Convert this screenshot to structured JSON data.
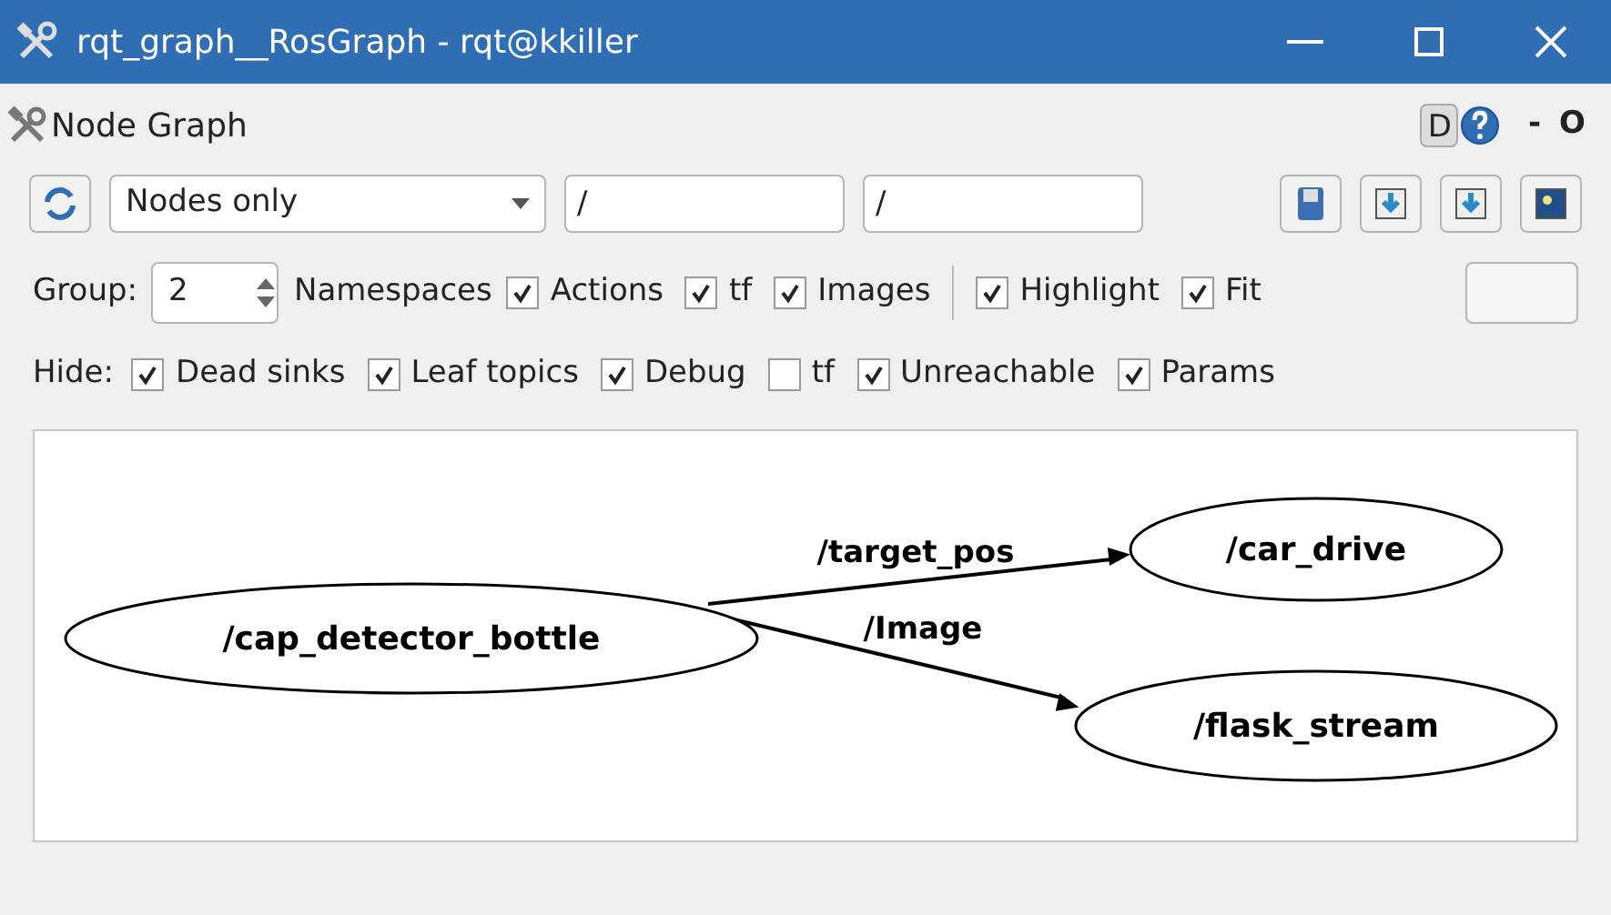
{
  "window": {
    "title": "rqt_graph__RosGraph - rqt@kkiller"
  },
  "plugin": {
    "title": "Node Graph",
    "help_buttons": [
      "D"
    ],
    "extra": [
      "-",
      "O"
    ]
  },
  "toolbar": {
    "mode": "Nodes only",
    "filters": [
      "/",
      "/"
    ]
  },
  "group_row": {
    "label": "Group:",
    "group": "2",
    "namespaces": "Namespaces",
    "options": [
      {
        "label": "Actions",
        "checked": true
      },
      {
        "label": "tf",
        "checked": true
      },
      {
        "label": "Images",
        "checked": true
      }
    ],
    "view_options": [
      {
        "label": "Highlight",
        "checked": true
      },
      {
        "label": "Fit",
        "checked": true
      }
    ]
  },
  "hide_row": {
    "label": "Hide:",
    "options": [
      {
        "label": "Dead sinks",
        "checked": true
      },
      {
        "label": "Leaf topics",
        "checked": true
      },
      {
        "label": "Debug",
        "checked": true
      },
      {
        "label": "tf",
        "checked": false
      },
      {
        "label": "Unreachable",
        "checked": true
      },
      {
        "label": "Params",
        "checked": true
      }
    ]
  },
  "graph": {
    "nodes": [
      {
        "name": "/cap_detector_bottle"
      },
      {
        "name": "/car_drive"
      },
      {
        "name": "/flask_stream"
      }
    ],
    "edges": [
      {
        "label": "/target_pos"
      },
      {
        "label": "/Image"
      }
    ]
  }
}
